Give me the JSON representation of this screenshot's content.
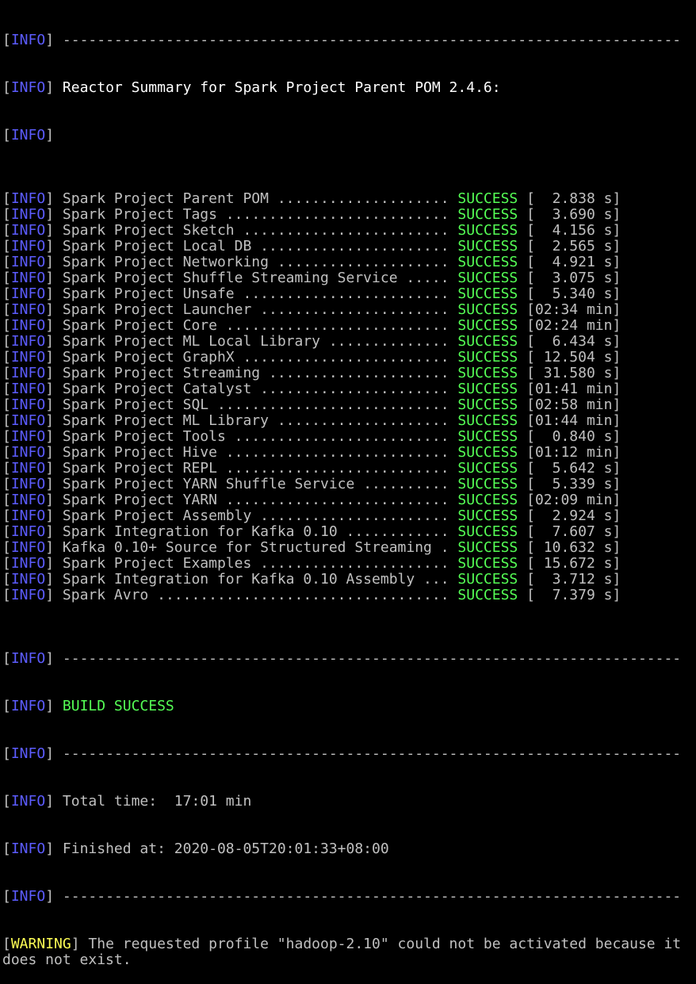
{
  "colors": {
    "background": "#000000",
    "info_tag": "#5c5cff",
    "warning_tag": "#ffff55",
    "success": "#55ff55",
    "text": "#c0c0c0",
    "header_text": "#ffffff"
  },
  "tags": {
    "info": "INFO",
    "warning": "WARNING"
  },
  "divider": "------------------------------------------------------------------------",
  "header": "Reactor Summary for Spark Project Parent POM 2.4.6:",
  "modules": [
    {
      "name": "Spark Project Parent POM",
      "status": "SUCCESS",
      "time": "[  2.838 s]"
    },
    {
      "name": "Spark Project Tags",
      "status": "SUCCESS",
      "time": "[  3.690 s]"
    },
    {
      "name": "Spark Project Sketch",
      "status": "SUCCESS",
      "time": "[  4.156 s]"
    },
    {
      "name": "Spark Project Local DB",
      "status": "SUCCESS",
      "time": "[  2.565 s]"
    },
    {
      "name": "Spark Project Networking",
      "status": "SUCCESS",
      "time": "[  4.921 s]"
    },
    {
      "name": "Spark Project Shuffle Streaming Service",
      "status": "SUCCESS",
      "time": "[  3.075 s]"
    },
    {
      "name": "Spark Project Unsafe",
      "status": "SUCCESS",
      "time": "[  5.340 s]"
    },
    {
      "name": "Spark Project Launcher",
      "status": "SUCCESS",
      "time": "[02:34 min]"
    },
    {
      "name": "Spark Project Core",
      "status": "SUCCESS",
      "time": "[02:24 min]"
    },
    {
      "name": "Spark Project ML Local Library",
      "status": "SUCCESS",
      "time": "[  6.434 s]"
    },
    {
      "name": "Spark Project GraphX",
      "status": "SUCCESS",
      "time": "[ 12.504 s]"
    },
    {
      "name": "Spark Project Streaming",
      "status": "SUCCESS",
      "time": "[ 31.580 s]"
    },
    {
      "name": "Spark Project Catalyst",
      "status": "SUCCESS",
      "time": "[01:41 min]"
    },
    {
      "name": "Spark Project SQL",
      "status": "SUCCESS",
      "time": "[02:58 min]"
    },
    {
      "name": "Spark Project ML Library",
      "status": "SUCCESS",
      "time": "[01:44 min]"
    },
    {
      "name": "Spark Project Tools",
      "status": "SUCCESS",
      "time": "[  0.840 s]"
    },
    {
      "name": "Spark Project Hive",
      "status": "SUCCESS",
      "time": "[01:12 min]"
    },
    {
      "name": "Spark Project REPL",
      "status": "SUCCESS",
      "time": "[  5.642 s]"
    },
    {
      "name": "Spark Project YARN Shuffle Service",
      "status": "SUCCESS",
      "time": "[  5.339 s]"
    },
    {
      "name": "Spark Project YARN",
      "status": "SUCCESS",
      "time": "[02:09 min]"
    },
    {
      "name": "Spark Project Assembly",
      "status": "SUCCESS",
      "time": "[  2.924 s]"
    },
    {
      "name": "Spark Integration for Kafka 0.10",
      "status": "SUCCESS",
      "time": "[  7.607 s]"
    },
    {
      "name": "Kafka 0.10+ Source for Structured Streaming",
      "status": "SUCCESS",
      "time": "[ 10.632 s]"
    },
    {
      "name": "Spark Project Examples",
      "status": "SUCCESS",
      "time": "[ 15.672 s]"
    },
    {
      "name": "Spark Integration for Kafka 0.10 Assembly",
      "status": "SUCCESS",
      "time": "[  3.712 s]"
    },
    {
      "name": "Spark Avro",
      "status": "SUCCESS",
      "time": "[  7.379 s]"
    }
  ],
  "build_result": "BUILD SUCCESS",
  "total_time": "Total time:  17:01 min",
  "finished_at": "Finished at: 2020-08-05T20:01:33+08:00",
  "warning_message": "The requested profile \"hadoop-2.10\" could not be activated because it does not exist."
}
